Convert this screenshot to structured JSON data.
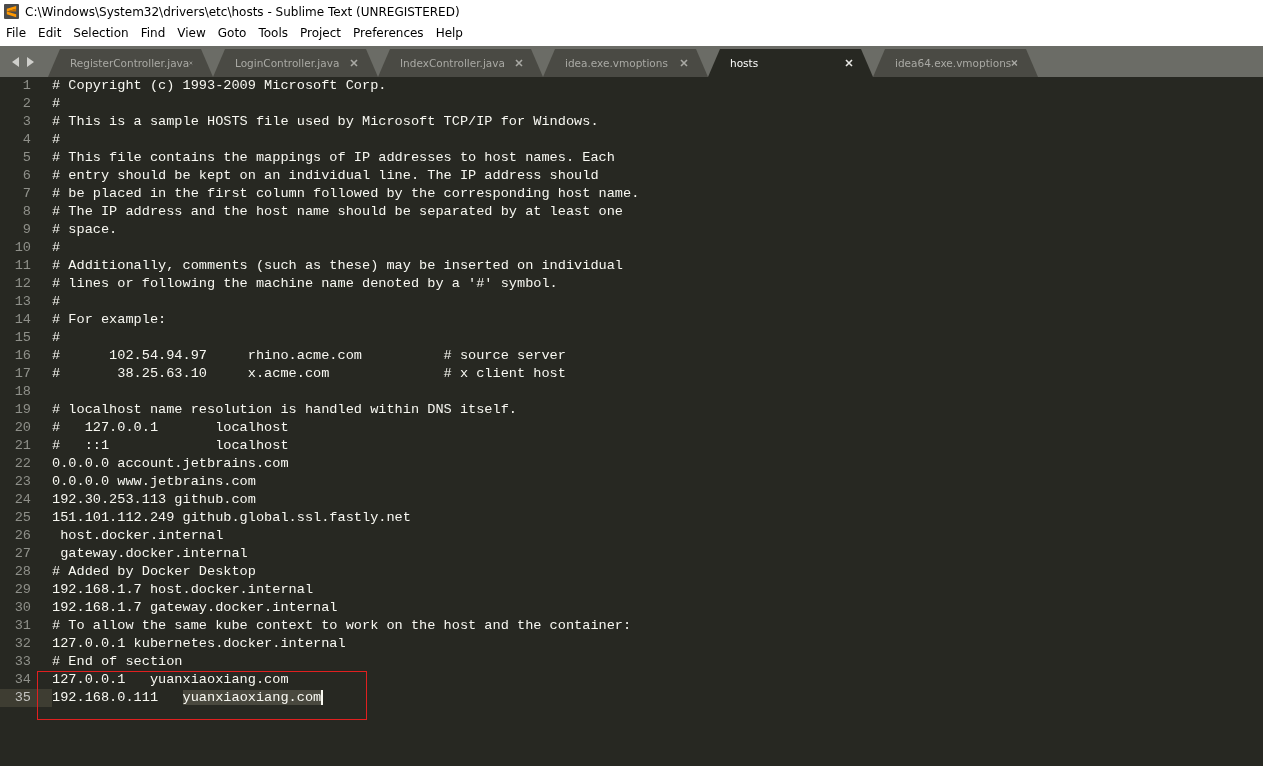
{
  "window": {
    "title": "C:\\Windows\\System32\\drivers\\etc\\hosts - Sublime Text (UNREGISTERED)"
  },
  "menu": [
    {
      "label": "File"
    },
    {
      "label": "Edit"
    },
    {
      "label": "Selection"
    },
    {
      "label": "Find"
    },
    {
      "label": "View"
    },
    {
      "label": "Goto"
    },
    {
      "label": "Tools"
    },
    {
      "label": "Project"
    },
    {
      "label": "Preferences"
    },
    {
      "label": "Help"
    }
  ],
  "tabs": [
    {
      "label": "RegisterController.java",
      "selected": false
    },
    {
      "label": "LoginController.java",
      "selected": false
    },
    {
      "label": "IndexController.java",
      "selected": false
    },
    {
      "label": "idea.exe.vmoptions",
      "selected": false
    },
    {
      "label": "hosts",
      "selected": true
    },
    {
      "label": "idea64.exe.vmoptions",
      "selected": false
    }
  ],
  "lines": [
    {
      "number": "1",
      "text": "# Copyright (c) 1993-2009 Microsoft Corp.",
      "current": false
    },
    {
      "number": "2",
      "text": "#",
      "current": false
    },
    {
      "number": "3",
      "text": "# This is a sample HOSTS file used by Microsoft TCP/IP for Windows.",
      "current": false
    },
    {
      "number": "4",
      "text": "#",
      "current": false
    },
    {
      "number": "5",
      "text": "# This file contains the mappings of IP addresses to host names. Each",
      "current": false
    },
    {
      "number": "6",
      "text": "# entry should be kept on an individual line. The IP address should",
      "current": false
    },
    {
      "number": "7",
      "text": "# be placed in the first column followed by the corresponding host name.",
      "current": false
    },
    {
      "number": "8",
      "text": "# The IP address and the host name should be separated by at least one",
      "current": false
    },
    {
      "number": "9",
      "text": "# space.",
      "current": false
    },
    {
      "number": "10",
      "text": "#",
      "current": false
    },
    {
      "number": "11",
      "text": "# Additionally, comments (such as these) may be inserted on individual",
      "current": false
    },
    {
      "number": "12",
      "text": "# lines or following the machine name denoted by a '#' symbol.",
      "current": false
    },
    {
      "number": "13",
      "text": "#",
      "current": false
    },
    {
      "number": "14",
      "text": "# For example:",
      "current": false
    },
    {
      "number": "15",
      "text": "#",
      "current": false
    },
    {
      "number": "16",
      "text": "#      102.54.94.97     rhino.acme.com          # source server",
      "current": false
    },
    {
      "number": "17",
      "text": "#       38.25.63.10     x.acme.com              # x client host",
      "current": false
    },
    {
      "number": "18",
      "current": false
    },
    {
      "number": "19",
      "text": "# localhost name resolution is handled within DNS itself.",
      "current": false
    },
    {
      "number": "20",
      "text": "#   127.0.0.1       localhost",
      "current": false
    },
    {
      "number": "21",
      "text": "#   ::1             localhost",
      "current": false
    },
    {
      "number": "22",
      "text": "0.0.0.0 account.jetbrains.com",
      "current": false
    },
    {
      "number": "23",
      "text": "0.0.0.0 www.jetbrains.com",
      "current": false
    },
    {
      "number": "24",
      "text": "192.30.253.113 github.com",
      "current": false
    },
    {
      "number": "25",
      "text": "151.101.112.249 github.global.ssl.fastly.net",
      "current": false
    },
    {
      "number": "26",
      "text": " host.docker.internal",
      "current": false
    },
    {
      "number": "27",
      "text": " gateway.docker.internal",
      "current": false
    },
    {
      "number": "28",
      "text": "# Added by Docker Desktop",
      "current": false
    },
    {
      "number": "29",
      "text": "192.168.1.7 host.docker.internal",
      "current": false
    },
    {
      "number": "30",
      "text": "192.168.1.7 gateway.docker.internal",
      "current": false
    },
    {
      "number": "31",
      "text": "# To allow the same kube context to work on the host and the container:",
      "current": false
    },
    {
      "number": "32",
      "text": "127.0.0.1 kubernetes.docker.internal",
      "current": false
    },
    {
      "number": "33",
      "text": "# End of section",
      "current": false
    },
    {
      "number": "34",
      "text": "127.0.0.1   yuanxiaoxiang.com",
      "current": false
    },
    {
      "number": "35",
      "text": "192.168.0.111   ",
      "selection": "yuanxiaoxiang.com",
      "current": true
    }
  ]
}
